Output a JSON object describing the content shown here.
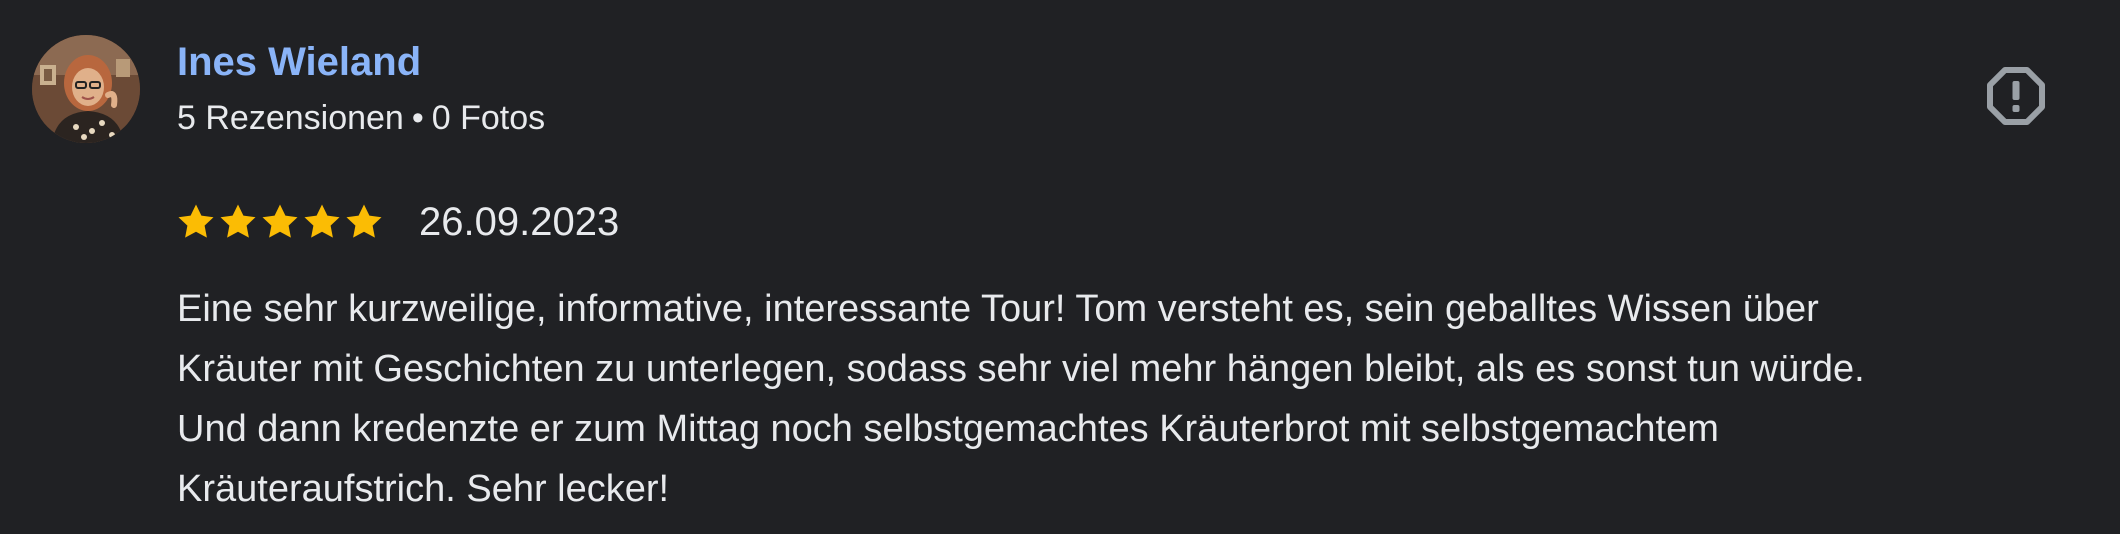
{
  "review": {
    "author": {
      "name": "Ines Wieland",
      "reviews_count": "5 Rezensionen",
      "separator": "•",
      "photos_count": "0 Fotos",
      "avatar_icon": "profile-photo"
    },
    "flag_icon": "report-icon",
    "rating": {
      "value": 5,
      "max": 5,
      "star_color": "#fbbc04"
    },
    "date": "26.09.2023",
    "text_lines": [
      "Eine sehr kurzweilige, informative, interessante Tour! Tom versteht es, sein geballtes Wissen über",
      "Kräuter mit Geschichten zu unterlegen, sodass sehr viel mehr hängen bleibt, als es sonst tun würde.",
      "Und dann kredenzte er zum Mittag noch selbstgemachtes Kräuterbrot mit selbstgemachtem",
      "Kräuteraufstrich. Sehr lecker!"
    ]
  },
  "colors": {
    "background": "#202124",
    "author_link": "#8ab4f8",
    "text": "#e8eaed",
    "icon": "#9aa0a6"
  }
}
